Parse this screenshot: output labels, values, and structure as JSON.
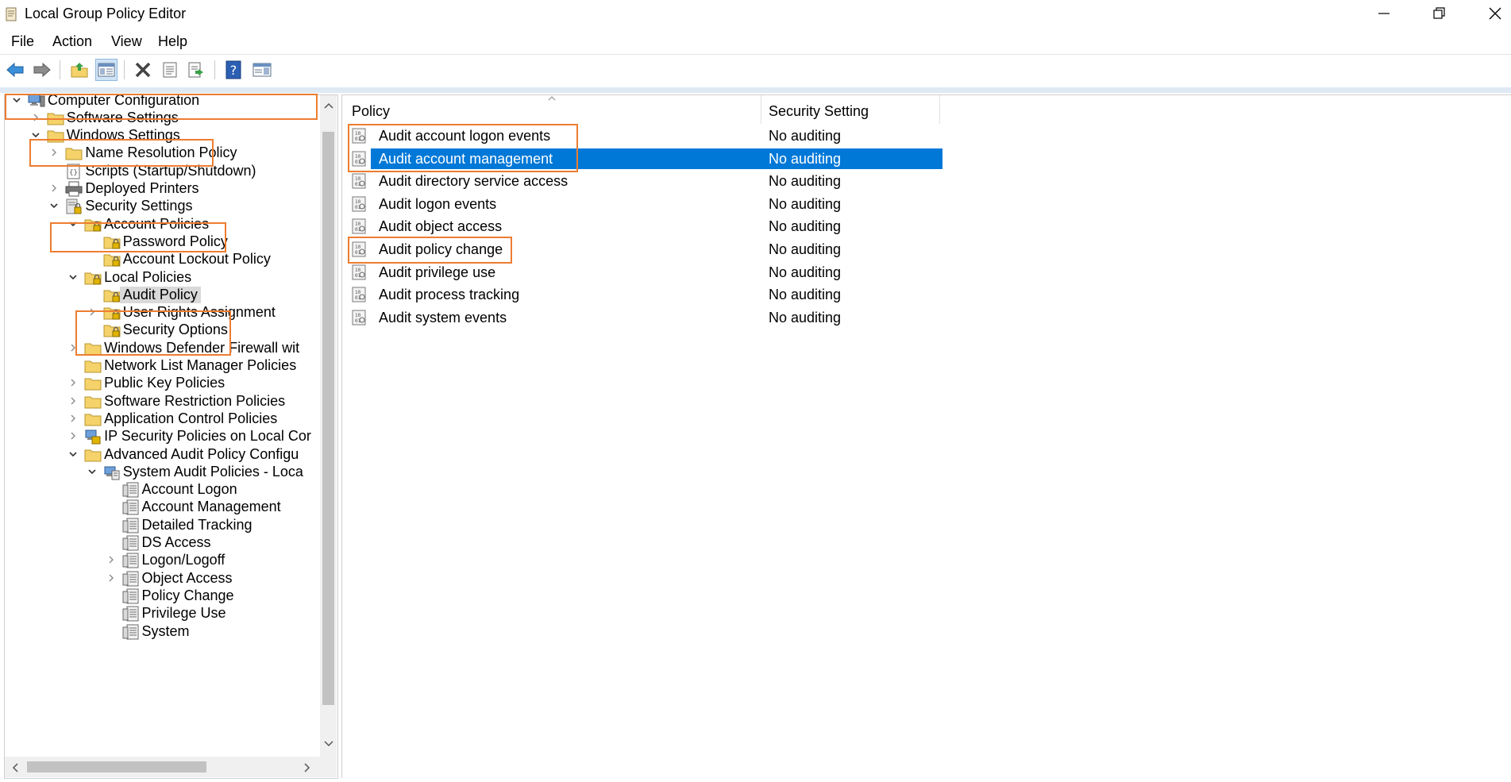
{
  "window": {
    "title": "Local Group Policy Editor",
    "controls": [
      "minimize-icon",
      "restore-icon",
      "close-icon"
    ]
  },
  "menu": [
    "File",
    "Action",
    "View",
    "Help"
  ],
  "toolbar": {
    "icons": [
      "back-arrow-icon",
      "forward-arrow-icon",
      "up-folder-icon",
      "show-hide-tree-icon",
      "delete-icon",
      "properties-icon",
      "export-list-icon",
      "help-icon",
      "action-pane-icon"
    ]
  },
  "tree": [
    {
      "label": "Computer Configuration",
      "icon": "computer-icon",
      "arrow": "expanded",
      "depth": 0
    },
    {
      "label": "Software Settings",
      "icon": "folder-icon",
      "arrow": "collapsed",
      "depth": 1
    },
    {
      "label": "Windows Settings",
      "icon": "folder-icon",
      "arrow": "expanded",
      "depth": 1
    },
    {
      "label": "Name Resolution Policy",
      "icon": "folder-icon",
      "arrow": "collapsed",
      "depth": 2
    },
    {
      "label": "Scripts (Startup/Shutdown)",
      "icon": "script-icon",
      "arrow": "none",
      "depth": 2
    },
    {
      "label": "Deployed Printers",
      "icon": "printer-icon",
      "arrow": "collapsed",
      "depth": 2
    },
    {
      "label": "Security Settings",
      "icon": "security-settings-icon",
      "arrow": "expanded",
      "depth": 2
    },
    {
      "label": "Account Policies",
      "icon": "locked-folder-icon",
      "arrow": "expanded",
      "depth": 3
    },
    {
      "label": "Password Policy",
      "icon": "locked-folder-icon",
      "arrow": "none",
      "depth": 4
    },
    {
      "label": "Account Lockout Policy",
      "icon": "locked-folder-icon",
      "arrow": "none",
      "depth": 4
    },
    {
      "label": "Local Policies",
      "icon": "locked-folder-icon",
      "arrow": "expanded",
      "depth": 3
    },
    {
      "label": "Audit Policy",
      "icon": "locked-folder-icon",
      "arrow": "none",
      "depth": 4,
      "selected": true
    },
    {
      "label": "User Rights Assignment",
      "icon": "locked-folder-icon",
      "arrow": "collapsed",
      "depth": 4
    },
    {
      "label": "Security Options",
      "icon": "locked-folder-icon",
      "arrow": "none",
      "depth": 4
    },
    {
      "label": "Windows Defender Firewall wit",
      "icon": "folder-icon",
      "arrow": "collapsed",
      "depth": 3
    },
    {
      "label": "Network List Manager Policies",
      "icon": "folder-icon",
      "arrow": "none",
      "depth": 3
    },
    {
      "label": "Public Key Policies",
      "icon": "folder-icon",
      "arrow": "collapsed",
      "depth": 3
    },
    {
      "label": "Software Restriction Policies",
      "icon": "folder-icon",
      "arrow": "collapsed",
      "depth": 3
    },
    {
      "label": "Application Control Policies",
      "icon": "folder-icon",
      "arrow": "collapsed",
      "depth": 3
    },
    {
      "label": "IP Security Policies on Local Cor",
      "icon": "ip-security-icon",
      "arrow": "collapsed",
      "depth": 3
    },
    {
      "label": "Advanced Audit Policy Configu",
      "icon": "folder-icon",
      "arrow": "expanded",
      "depth": 3
    },
    {
      "label": "System Audit Policies - Loca",
      "icon": "audit-policies-icon",
      "arrow": "expanded",
      "depth": 4
    },
    {
      "label": "Account Logon",
      "icon": "policy-doc-icon",
      "arrow": "none",
      "depth": 5
    },
    {
      "label": "Account Management",
      "icon": "policy-doc-icon",
      "arrow": "none",
      "depth": 5
    },
    {
      "label": "Detailed Tracking",
      "icon": "policy-doc-icon",
      "arrow": "none",
      "depth": 5
    },
    {
      "label": "DS Access",
      "icon": "policy-doc-icon",
      "arrow": "none",
      "depth": 5
    },
    {
      "label": "Logon/Logoff",
      "icon": "policy-doc-icon",
      "arrow": "collapsed",
      "depth": 5
    },
    {
      "label": "Object Access",
      "icon": "policy-doc-icon",
      "arrow": "collapsed",
      "depth": 5
    },
    {
      "label": "Policy Change",
      "icon": "policy-doc-icon",
      "arrow": "none",
      "depth": 5
    },
    {
      "label": "Privilege Use",
      "icon": "policy-doc-icon",
      "arrow": "none",
      "depth": 5
    },
    {
      "label": "System",
      "icon": "policy-doc-icon",
      "arrow": "none",
      "depth": 5
    }
  ],
  "list": {
    "columns": [
      "Policy",
      "Security Setting"
    ],
    "rows": [
      {
        "policy": "Audit account logon events",
        "setting": "No auditing",
        "icon": "audit-setting-icon"
      },
      {
        "policy": "Audit account management",
        "setting": "No auditing",
        "icon": "audit-setting-icon",
        "selected": true
      },
      {
        "policy": "Audit directory service access",
        "setting": "No auditing",
        "icon": "audit-setting-icon"
      },
      {
        "policy": "Audit logon events",
        "setting": "No auditing",
        "icon": "audit-setting-icon"
      },
      {
        "policy": "Audit object access",
        "setting": "No auditing",
        "icon": "audit-setting-icon"
      },
      {
        "policy": "Audit policy change",
        "setting": "No auditing",
        "icon": "audit-setting-icon"
      },
      {
        "policy": "Audit privilege use",
        "setting": "No auditing",
        "icon": "audit-setting-icon"
      },
      {
        "policy": "Audit process tracking",
        "setting": "No auditing",
        "icon": "audit-setting-icon"
      },
      {
        "policy": "Audit system events",
        "setting": "No auditing",
        "icon": "audit-setting-icon"
      }
    ]
  },
  "colors": {
    "selection": "#0078d7",
    "highlight_box": "#ed7d31",
    "tree_selected": "#d9d9d9",
    "folder": "#f5d36a"
  }
}
